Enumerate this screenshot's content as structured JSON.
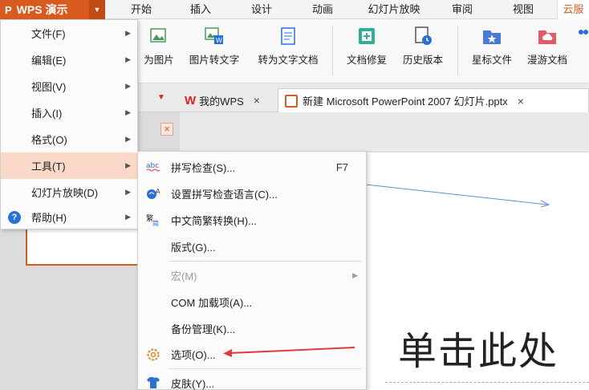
{
  "app": {
    "brand_label": "WPS 演示",
    "brand_logo": "P"
  },
  "menubar": {
    "tabs": [
      {
        "label": "开始"
      },
      {
        "label": "插入"
      },
      {
        "label": "设计"
      },
      {
        "label": "动画"
      },
      {
        "label": "幻灯片放映"
      },
      {
        "label": "审阅"
      },
      {
        "label": "视图"
      },
      {
        "label": "云服"
      }
    ]
  },
  "ribbon": {
    "items": [
      {
        "label": "为图片",
        "icon": "image-convert-icon"
      },
      {
        "label": "图片转文字",
        "icon": "image-to-text-icon"
      },
      {
        "label": "转为文字文档",
        "icon": "to-word-doc-icon"
      },
      {
        "label": "文档修复",
        "icon": "doc-repair-icon"
      },
      {
        "label": "历史版本",
        "icon": "history-version-icon"
      },
      {
        "label": "星标文件",
        "icon": "star-file-icon"
      },
      {
        "label": "漫游文档",
        "icon": "roaming-doc-icon"
      }
    ]
  },
  "tabs": {
    "my_wps": "我的WPS",
    "document": "新建 Microsoft PowerPoint 2007 幻灯片.pptx",
    "close_glyph": "×"
  },
  "main_menu": {
    "items": [
      {
        "label": "文件(F)"
      },
      {
        "label": "编辑(E)"
      },
      {
        "label": "视图(V)"
      },
      {
        "label": "插入(I)"
      },
      {
        "label": "格式(O)"
      },
      {
        "label": "工具(T)"
      },
      {
        "label": "幻灯片放映(D)"
      },
      {
        "label": "帮助(H)"
      }
    ]
  },
  "tools_submenu": {
    "items": [
      {
        "label": "拼写检查(S)...",
        "shortcut": "F7",
        "icon": "spell-check-icon"
      },
      {
        "label": "设置拼写检查语言(C)...",
        "icon": "spell-language-icon"
      },
      {
        "label": "中文简繁转换(H)...",
        "icon": "chinese-convert-icon"
      },
      {
        "label": "版式(G)..."
      },
      {
        "label": "宏(M)",
        "disabled": true
      },
      {
        "label": "COM 加载项(A)..."
      },
      {
        "label": "备份管理(K)..."
      },
      {
        "label": "选项(O)...",
        "icon": "options-gear-icon"
      },
      {
        "label": "皮肤(Y)...",
        "icon": "skin-shirt-icon"
      }
    ]
  },
  "slide": {
    "title_placeholder": "单击此处"
  },
  "colors": {
    "brand": "#d85a1e",
    "menu_highlight": "#fbd9c8",
    "annotation_arrow": "#e03a3a",
    "slide_line": "#5b8fd6"
  }
}
